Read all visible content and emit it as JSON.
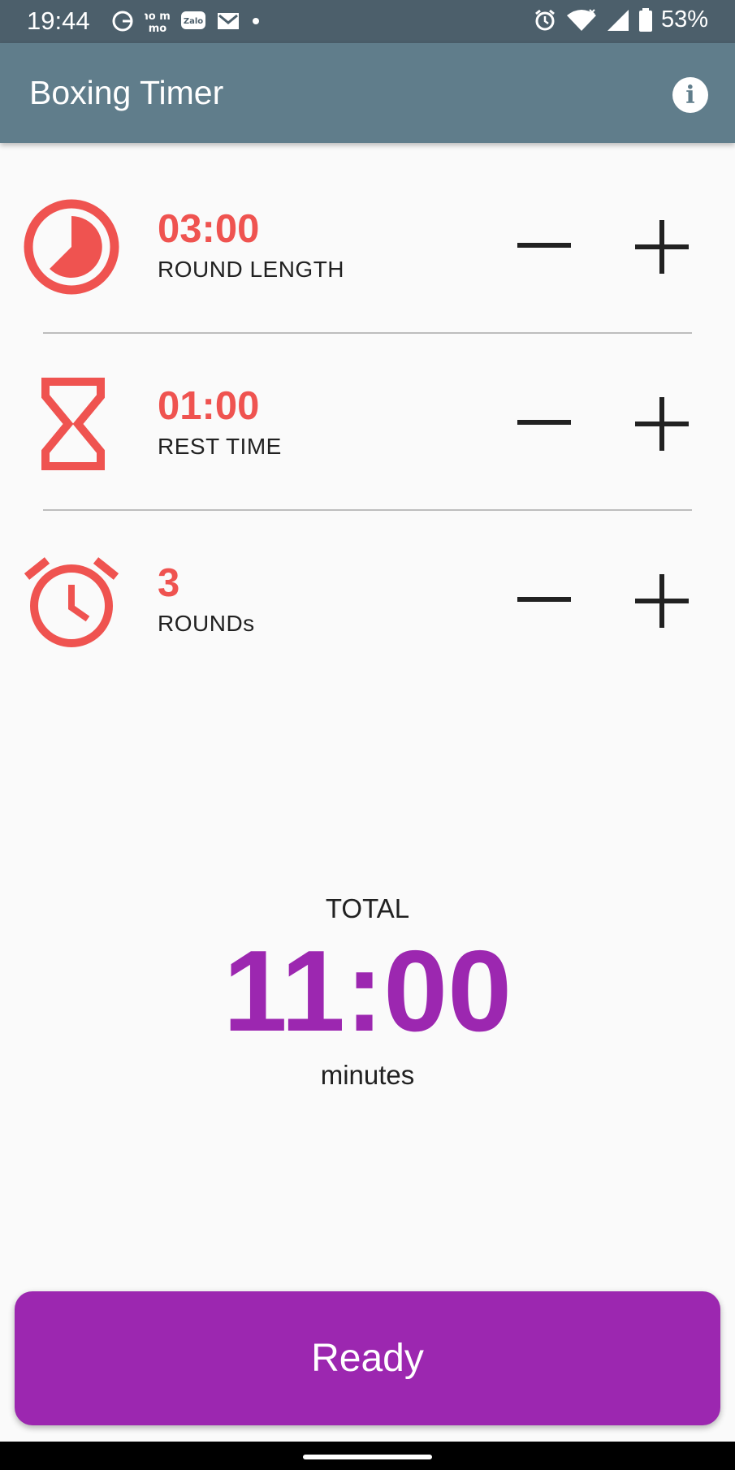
{
  "status_bar": {
    "time": "19:44",
    "battery": "53%",
    "left_icons": [
      "g-icon",
      "momo-icon",
      "zalo-icon",
      "mail-icon",
      "dot-icon"
    ],
    "right_icons": [
      "alarm-icon",
      "wifi-icon",
      "signal-icon",
      "battery-icon"
    ],
    "momo_text": "mo mo",
    "zalo_text": "Zalo"
  },
  "app_bar": {
    "title": "Boxing Timer",
    "info_icon": "info-icon",
    "info_glyph": "i"
  },
  "settings": [
    {
      "value": "03:00",
      "label": "ROUND LENGTH",
      "icon": "timer-pie-icon"
    },
    {
      "value": "01:00",
      "label": "REST TIME",
      "icon": "hourglass-icon"
    },
    {
      "value": "3",
      "label": "ROUNDs",
      "icon": "alarm-clock-icon"
    }
  ],
  "total": {
    "label": "TOTAL",
    "value": "11:00",
    "unit": "minutes"
  },
  "ready_button": {
    "label": "Ready"
  },
  "colors": {
    "accent_red": "#ef5350",
    "accent_purple": "#9c27b0",
    "app_bar": "#607d8b",
    "status_bar": "#4c5f6b"
  }
}
